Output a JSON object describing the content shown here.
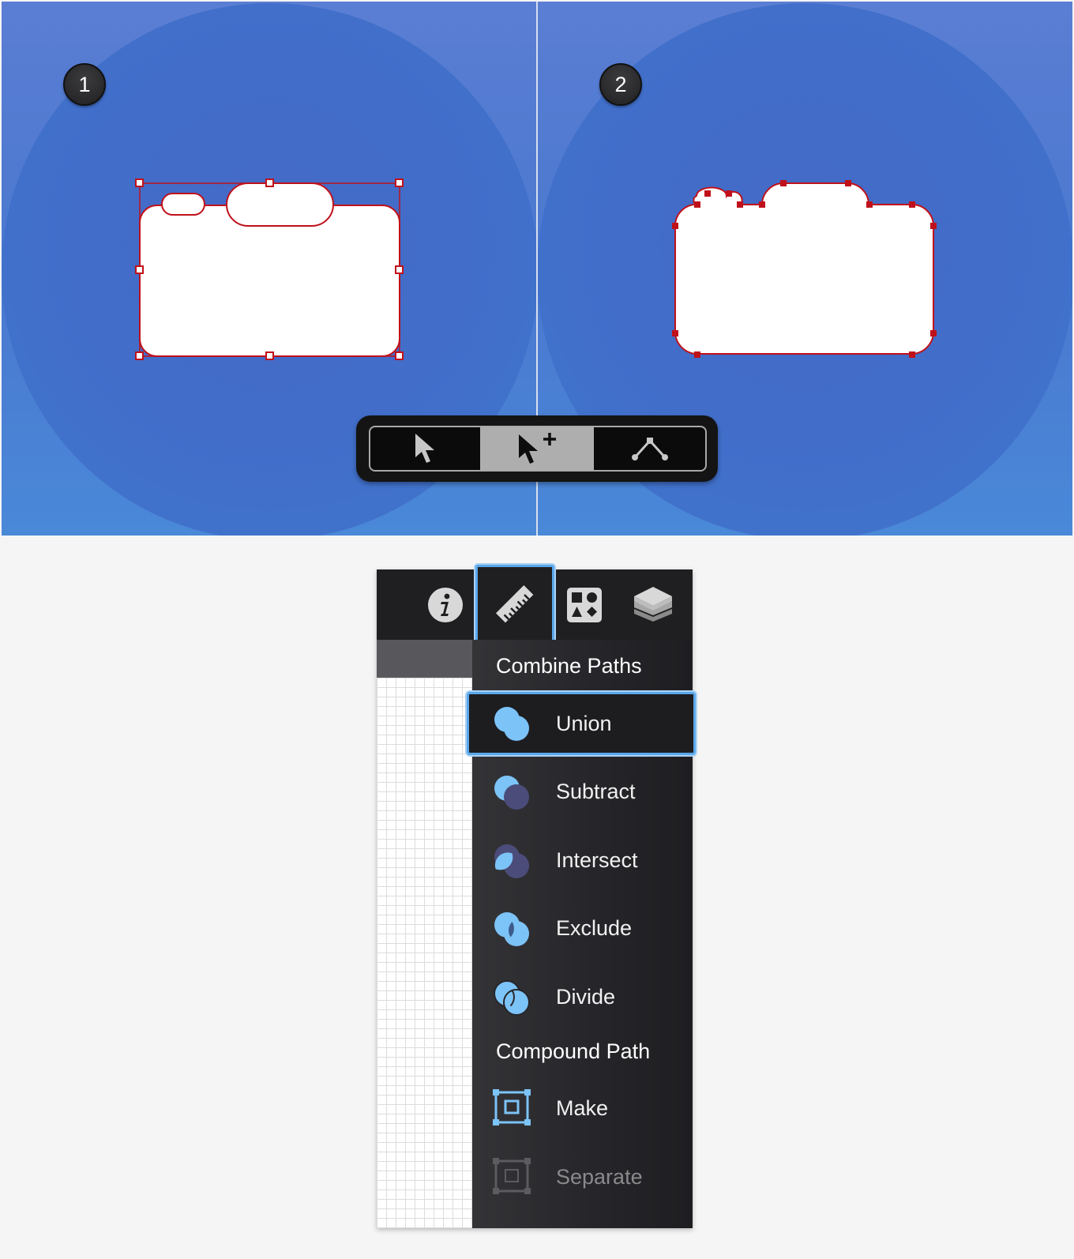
{
  "steps": {
    "step1": "1",
    "step2": "2"
  },
  "toolbar": {
    "tools": [
      {
        "name": "select-tool",
        "icon": "arrow-pointer-icon",
        "active": false
      },
      {
        "name": "add-select-tool",
        "icon": "arrow-pointer-plus-icon",
        "active": true
      },
      {
        "name": "node-tool",
        "icon": "node-path-icon",
        "active": false
      }
    ]
  },
  "inspector": {
    "tabs": [
      {
        "icon": "info-icon",
        "active": false
      },
      {
        "icon": "ruler-icon",
        "active": true
      },
      {
        "icon": "shapes-icon",
        "active": false
      },
      {
        "icon": "layers-icon",
        "active": false
      }
    ],
    "combine_title": "Combine Paths",
    "combine_items": [
      {
        "label": "Union",
        "icon": "union-icon",
        "selected": true
      },
      {
        "label": "Subtract",
        "icon": "subtract-icon",
        "selected": false
      },
      {
        "label": "Intersect",
        "icon": "intersect-icon",
        "selected": false
      },
      {
        "label": "Exclude",
        "icon": "exclude-icon",
        "selected": false
      },
      {
        "label": "Divide",
        "icon": "divide-icon",
        "selected": false
      }
    ],
    "compound_title": "Compound Path",
    "compound_items": [
      {
        "label": "Make",
        "icon": "make-compound-icon",
        "enabled": true
      },
      {
        "label": "Separate",
        "icon": "separate-compound-icon",
        "enabled": false
      }
    ]
  },
  "colors": {
    "canvas_blue": "#4469c6",
    "selection_red": "#c0111a",
    "accent_blue": "#5aa7ea",
    "panel_dark": "#1f1f21",
    "icon_blue": "#7cc3f7"
  }
}
